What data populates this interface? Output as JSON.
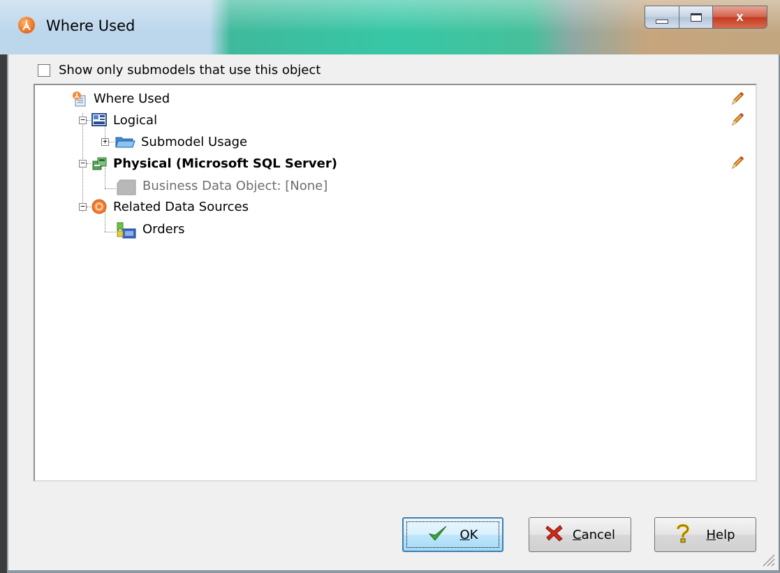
{
  "window": {
    "title": "Where Used",
    "close_label": "x"
  },
  "options": {
    "show_only_submodels_label": "Show only submodels that use this object",
    "show_only_submodels_checked": false
  },
  "tree": {
    "root": {
      "label": "Where Used"
    },
    "logical": {
      "label": "Logical",
      "expander": "−"
    },
    "submodel_usage": {
      "label": "Submodel Usage",
      "expander": "+"
    },
    "physical": {
      "label": "Physical (Microsoft SQL Server)",
      "expander": "−"
    },
    "business_data_object": {
      "label": "Business Data Object: [None]"
    },
    "related_data_sources": {
      "label": "Related Data Sources",
      "expander": "−"
    },
    "orders": {
      "label": "Orders"
    }
  },
  "buttons": {
    "ok": {
      "mnemonic": "O",
      "rest": "K"
    },
    "cancel": {
      "mnemonic": "C",
      "rest": "ancel"
    },
    "help": {
      "mnemonic": "H",
      "rest": "elp"
    }
  },
  "colors": {
    "accent_titlebar": "#37c7a6",
    "ok_border": "#3c7fb1",
    "grey_text": "#6d6d6d"
  }
}
